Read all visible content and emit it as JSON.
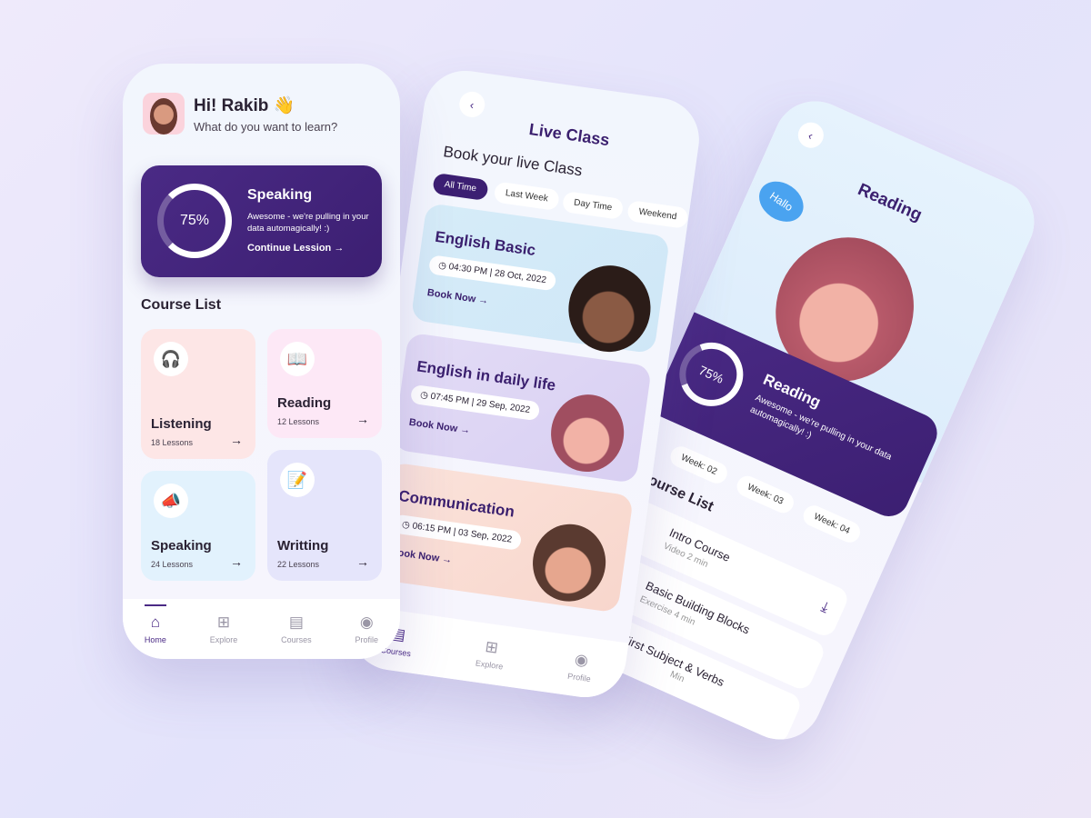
{
  "home": {
    "greeting": "Hi! Rakib",
    "wave_icon": "👋",
    "subtitle": "What do you want to learn?",
    "progress_card": {
      "percent_label": "75%",
      "percent": 75,
      "title": "Speaking",
      "text": "Awesome - we're pulling in your data automagically! :)",
      "cta": "Continue Lession →"
    },
    "section_title": "Course List",
    "courses": [
      {
        "title": "Listening",
        "lessons": "18 Lessons",
        "icon": "🎧",
        "color": "#fde6e6"
      },
      {
        "title": "Reading",
        "lessons": "12 Lessons",
        "icon": "📖",
        "color": "#fde8f6"
      },
      {
        "title": "Speaking",
        "lessons": "24 Lessons",
        "icon": "📣",
        "color": "#e2f2fd"
      },
      {
        "title": "Writting",
        "lessons": "22 Lessons",
        "icon": "📝",
        "color": "#e5e5fb"
      }
    ],
    "nav": [
      "Home",
      "Explore",
      "Courses",
      "Profile"
    ]
  },
  "live": {
    "back_icon": "‹",
    "title": "Live Class",
    "heading": "Book your live Class",
    "filters": [
      "All Time",
      "Last Week",
      "Day Time",
      "Weekend"
    ],
    "classes": [
      {
        "title": "English Basic",
        "time": "04:30 PM | 28 Oct, 2022",
        "cta": "Book Now →"
      },
      {
        "title": "English in daily life",
        "time": "07:45 PM | 29 Sep, 2022",
        "cta": "Book Now →"
      },
      {
        "title": "Communication",
        "time": "06:15 PM | 03 Sep, 2022",
        "cta": "Book Now →"
      }
    ],
    "nav": [
      "Courses",
      "Explore",
      "Profile"
    ]
  },
  "reading": {
    "back_icon": "‹",
    "title": "Reading",
    "bubble": "Hallo",
    "progress_card": {
      "percent_label": "75%",
      "title": "Reading",
      "text": "Awesome - we're pulling in your data automagically! :)"
    },
    "weeks": [
      "Week: 02",
      "Week: 03",
      "Week: 04"
    ],
    "section_title": "Course List",
    "lessons": [
      {
        "title": "Intro Course",
        "sub": "Video 2 min"
      },
      {
        "title": "Basic Building Blocks",
        "sub": "Exercise 4 min"
      },
      {
        "title": "First Subject & Verbs",
        "sub": "Min"
      }
    ]
  },
  "colors": {
    "accent": "#4a2a85"
  }
}
